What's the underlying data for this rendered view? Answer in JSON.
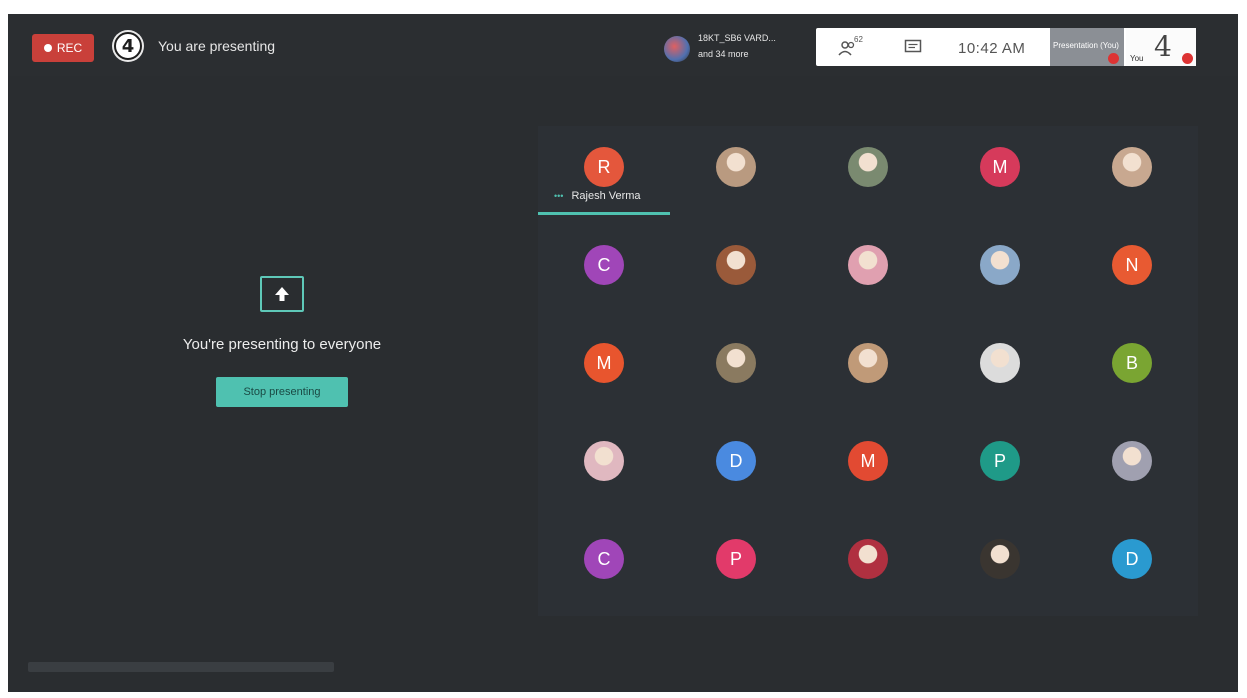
{
  "topbar": {
    "rec_label": "REC",
    "logo_text": "4",
    "presenting_title": "You are presenting",
    "group_name": "18KT_SB6 VARD...",
    "group_more": "and 34 more",
    "people_count": "62",
    "clock": "10:42 AM"
  },
  "thumbnails": {
    "presentation_label": "Presentation (You)",
    "you_label": "You",
    "you_number": "4"
  },
  "main": {
    "share_message": "You're presenting to everyone",
    "stop_button": "Stop presenting"
  },
  "speaker": {
    "name": "Rajesh Verma",
    "dots": "•••"
  },
  "participants": [
    {
      "initial": "R",
      "color": "#e4573c",
      "photo": false
    },
    {
      "initial": "",
      "color": "#b99a80",
      "photo": true
    },
    {
      "initial": "",
      "color": "#7a8a70",
      "photo": true
    },
    {
      "initial": "M",
      "color": "#d63a5b",
      "photo": false
    },
    {
      "initial": "",
      "color": "#c8a890",
      "photo": true
    },
    {
      "initial": "C",
      "color": "#a046b8",
      "photo": false
    },
    {
      "initial": "",
      "color": "#9a5a3a",
      "photo": true
    },
    {
      "initial": "",
      "color": "#e0a0b0",
      "photo": true
    },
    {
      "initial": "",
      "color": "#8aa8c8",
      "photo": true
    },
    {
      "initial": "N",
      "color": "#e85a32",
      "photo": false
    },
    {
      "initial": "M",
      "color": "#e8552e",
      "photo": false
    },
    {
      "initial": "",
      "color": "#8a7a60",
      "photo": true
    },
    {
      "initial": "",
      "color": "#c09a78",
      "photo": true
    },
    {
      "initial": "",
      "color": "#dcdcdc",
      "photo": true
    },
    {
      "initial": "B",
      "color": "#7aa532",
      "photo": false
    },
    {
      "initial": "",
      "color": "#e0b8c0",
      "photo": true
    },
    {
      "initial": "D",
      "color": "#4a8ae0",
      "photo": false
    },
    {
      "initial": "M",
      "color": "#e24a32",
      "photo": false
    },
    {
      "initial": "P",
      "color": "#1f9a88",
      "photo": false
    },
    {
      "initial": "",
      "color": "#a0a0b0",
      "photo": true
    },
    {
      "initial": "C",
      "color": "#a046b8",
      "photo": false
    },
    {
      "initial": "P",
      "color": "#e23a6a",
      "photo": false
    },
    {
      "initial": "",
      "color": "#b03040",
      "photo": true
    },
    {
      "initial": "",
      "color": "#3a3530",
      "photo": true
    },
    {
      "initial": "D",
      "color": "#2a9ad0",
      "photo": false
    }
  ]
}
